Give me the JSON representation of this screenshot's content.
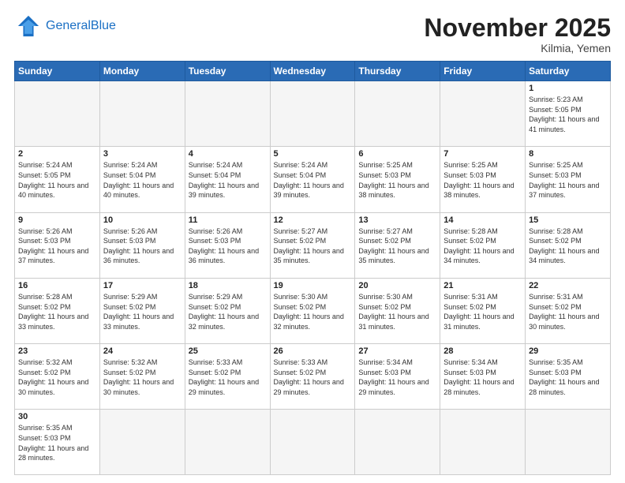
{
  "header": {
    "logo_general": "General",
    "logo_blue": "Blue",
    "month_title": "November 2025",
    "location": "Kilmia, Yemen"
  },
  "days_of_week": [
    "Sunday",
    "Monday",
    "Tuesday",
    "Wednesday",
    "Thursday",
    "Friday",
    "Saturday"
  ],
  "weeks": [
    [
      {
        "day": "",
        "info": ""
      },
      {
        "day": "",
        "info": ""
      },
      {
        "day": "",
        "info": ""
      },
      {
        "day": "",
        "info": ""
      },
      {
        "day": "",
        "info": ""
      },
      {
        "day": "",
        "info": ""
      },
      {
        "day": "1",
        "info": "Sunrise: 5:23 AM\nSunset: 5:05 PM\nDaylight: 11 hours and 41 minutes."
      }
    ],
    [
      {
        "day": "2",
        "info": "Sunrise: 5:24 AM\nSunset: 5:05 PM\nDaylight: 11 hours and 40 minutes."
      },
      {
        "day": "3",
        "info": "Sunrise: 5:24 AM\nSunset: 5:04 PM\nDaylight: 11 hours and 40 minutes."
      },
      {
        "day": "4",
        "info": "Sunrise: 5:24 AM\nSunset: 5:04 PM\nDaylight: 11 hours and 39 minutes."
      },
      {
        "day": "5",
        "info": "Sunrise: 5:24 AM\nSunset: 5:04 PM\nDaylight: 11 hours and 39 minutes."
      },
      {
        "day": "6",
        "info": "Sunrise: 5:25 AM\nSunset: 5:03 PM\nDaylight: 11 hours and 38 minutes."
      },
      {
        "day": "7",
        "info": "Sunrise: 5:25 AM\nSunset: 5:03 PM\nDaylight: 11 hours and 38 minutes."
      },
      {
        "day": "8",
        "info": "Sunrise: 5:25 AM\nSunset: 5:03 PM\nDaylight: 11 hours and 37 minutes."
      }
    ],
    [
      {
        "day": "9",
        "info": "Sunrise: 5:26 AM\nSunset: 5:03 PM\nDaylight: 11 hours and 37 minutes."
      },
      {
        "day": "10",
        "info": "Sunrise: 5:26 AM\nSunset: 5:03 PM\nDaylight: 11 hours and 36 minutes."
      },
      {
        "day": "11",
        "info": "Sunrise: 5:26 AM\nSunset: 5:03 PM\nDaylight: 11 hours and 36 minutes."
      },
      {
        "day": "12",
        "info": "Sunrise: 5:27 AM\nSunset: 5:02 PM\nDaylight: 11 hours and 35 minutes."
      },
      {
        "day": "13",
        "info": "Sunrise: 5:27 AM\nSunset: 5:02 PM\nDaylight: 11 hours and 35 minutes."
      },
      {
        "day": "14",
        "info": "Sunrise: 5:28 AM\nSunset: 5:02 PM\nDaylight: 11 hours and 34 minutes."
      },
      {
        "day": "15",
        "info": "Sunrise: 5:28 AM\nSunset: 5:02 PM\nDaylight: 11 hours and 34 minutes."
      }
    ],
    [
      {
        "day": "16",
        "info": "Sunrise: 5:28 AM\nSunset: 5:02 PM\nDaylight: 11 hours and 33 minutes."
      },
      {
        "day": "17",
        "info": "Sunrise: 5:29 AM\nSunset: 5:02 PM\nDaylight: 11 hours and 33 minutes."
      },
      {
        "day": "18",
        "info": "Sunrise: 5:29 AM\nSunset: 5:02 PM\nDaylight: 11 hours and 32 minutes."
      },
      {
        "day": "19",
        "info": "Sunrise: 5:30 AM\nSunset: 5:02 PM\nDaylight: 11 hours and 32 minutes."
      },
      {
        "day": "20",
        "info": "Sunrise: 5:30 AM\nSunset: 5:02 PM\nDaylight: 11 hours and 31 minutes."
      },
      {
        "day": "21",
        "info": "Sunrise: 5:31 AM\nSunset: 5:02 PM\nDaylight: 11 hours and 31 minutes."
      },
      {
        "day": "22",
        "info": "Sunrise: 5:31 AM\nSunset: 5:02 PM\nDaylight: 11 hours and 30 minutes."
      }
    ],
    [
      {
        "day": "23",
        "info": "Sunrise: 5:32 AM\nSunset: 5:02 PM\nDaylight: 11 hours and 30 minutes."
      },
      {
        "day": "24",
        "info": "Sunrise: 5:32 AM\nSunset: 5:02 PM\nDaylight: 11 hours and 30 minutes."
      },
      {
        "day": "25",
        "info": "Sunrise: 5:33 AM\nSunset: 5:02 PM\nDaylight: 11 hours and 29 minutes."
      },
      {
        "day": "26",
        "info": "Sunrise: 5:33 AM\nSunset: 5:02 PM\nDaylight: 11 hours and 29 minutes."
      },
      {
        "day": "27",
        "info": "Sunrise: 5:34 AM\nSunset: 5:03 PM\nDaylight: 11 hours and 29 minutes."
      },
      {
        "day": "28",
        "info": "Sunrise: 5:34 AM\nSunset: 5:03 PM\nDaylight: 11 hours and 28 minutes."
      },
      {
        "day": "29",
        "info": "Sunrise: 5:35 AM\nSunset: 5:03 PM\nDaylight: 11 hours and 28 minutes."
      }
    ],
    [
      {
        "day": "30",
        "info": "Sunrise: 5:35 AM\nSunset: 5:03 PM\nDaylight: 11 hours and 28 minutes."
      },
      {
        "day": "",
        "info": ""
      },
      {
        "day": "",
        "info": ""
      },
      {
        "day": "",
        "info": ""
      },
      {
        "day": "",
        "info": ""
      },
      {
        "day": "",
        "info": ""
      },
      {
        "day": "",
        "info": ""
      }
    ]
  ]
}
